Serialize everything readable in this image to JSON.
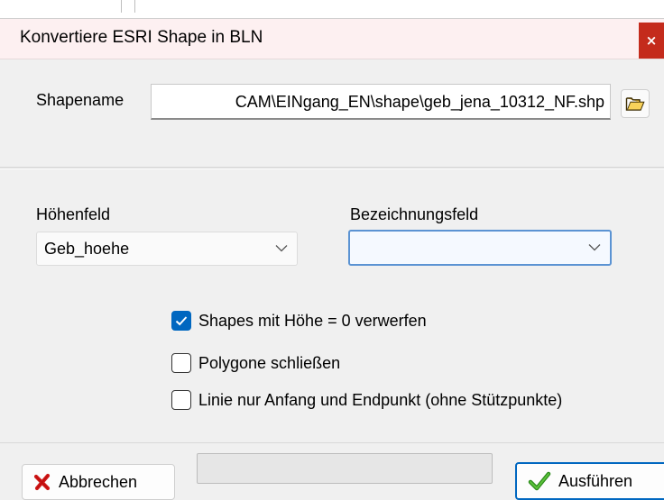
{
  "dialog": {
    "title": "Konvertiere ESRI Shape in BLN",
    "close_label": "×"
  },
  "shape": {
    "label": "Shapename",
    "path": "CAM\\EINgang_EN\\shape\\geb_jena_10312_NF.shp",
    "browse_icon": "folder-open-icon"
  },
  "fields": {
    "height_label": "Höhenfeld",
    "height_value": "Geb_hoehe",
    "name_label": "Bezeichnungsfeld",
    "name_value": ""
  },
  "options": [
    {
      "label": "Shapes mit Höhe = 0 verwerfen",
      "checked": true
    },
    {
      "label": "Polygone schließen",
      "checked": false
    },
    {
      "label": "Linie nur Anfang und Endpunkt (ohne Stützpunkte)",
      "checked": false
    }
  ],
  "buttons": {
    "cancel_label": "Abbrechen",
    "cancel_icon": "red-x-icon",
    "run_label": "Ausführen",
    "run_icon": "green-check-icon"
  },
  "progress": {
    "value": 0
  }
}
